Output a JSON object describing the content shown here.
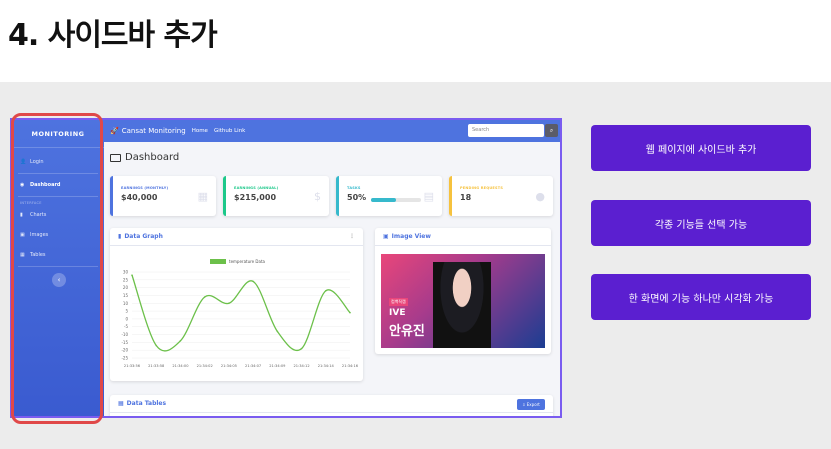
{
  "slide": {
    "title": "4. 사이드바 추가"
  },
  "sidebar": {
    "brand": "MONITORING",
    "items": [
      {
        "label": "Login",
        "icon": "user-icon"
      },
      {
        "label": "Dashboard",
        "icon": "dashboard-icon"
      },
      {
        "label": "Charts",
        "icon": "chart-icon"
      },
      {
        "label": "Images",
        "icon": "image-icon"
      },
      {
        "label": "Tables",
        "icon": "table-icon"
      }
    ],
    "heading": "INTERFACE",
    "toggle": "‹"
  },
  "topbar": {
    "brand": "Cansat Monitoring",
    "links": [
      "Home",
      "Github Link"
    ],
    "search_placeholder": "Search"
  },
  "page_title": "Dashboard",
  "cards": [
    {
      "label": "EARNINGS (MONTHLY)",
      "value": "$40,000",
      "color": "#4e73df",
      "icon": "calendar-icon"
    },
    {
      "label": "EARNINGS (ANNUAL)",
      "value": "$215,000",
      "color": "#1cc88a",
      "icon": "dollar-icon"
    },
    {
      "label": "TASKS",
      "value": "50%",
      "color": "#36b9cc",
      "icon": "clipboard-icon",
      "progress": 0.5
    },
    {
      "label": "PENDING REQUESTS",
      "value": "18",
      "color": "#f6c23e",
      "icon": "comments-icon"
    }
  ],
  "graph_panel": {
    "title": "Data Graph",
    "legend": "temperature Data"
  },
  "chart_data": {
    "type": "line",
    "x": [
      "21:33:56",
      "21:33:58",
      "21:34:00",
      "21:34:02",
      "21:34:05",
      "21:34:07",
      "21:34:09",
      "21:34:12",
      "21:34:14",
      "21:34:16"
    ],
    "series": [
      {
        "name": "temperature Data",
        "values": [
          28,
          -17,
          -14,
          14,
          10,
          24,
          -8,
          -19,
          18,
          4
        ],
        "color": "#6cc04a"
      }
    ],
    "ylim": [
      -25,
      30
    ],
    "yticks": [
      30,
      25,
      20,
      15,
      10,
      5,
      0,
      -5,
      -10,
      -15,
      -20,
      -25
    ]
  },
  "image_panel": {
    "title": "Image View",
    "caption_tag": "컴백직캠",
    "caption_group": "IVE",
    "caption_name": "안유진"
  },
  "tables_panel": {
    "title": "Data Tables",
    "export_label": "Export"
  },
  "notes": [
    "웹 페이지에 사이드바 추가",
    "각종 기능들 선택 가능",
    "한 화면에 기능 하나만 시각화 가능"
  ]
}
